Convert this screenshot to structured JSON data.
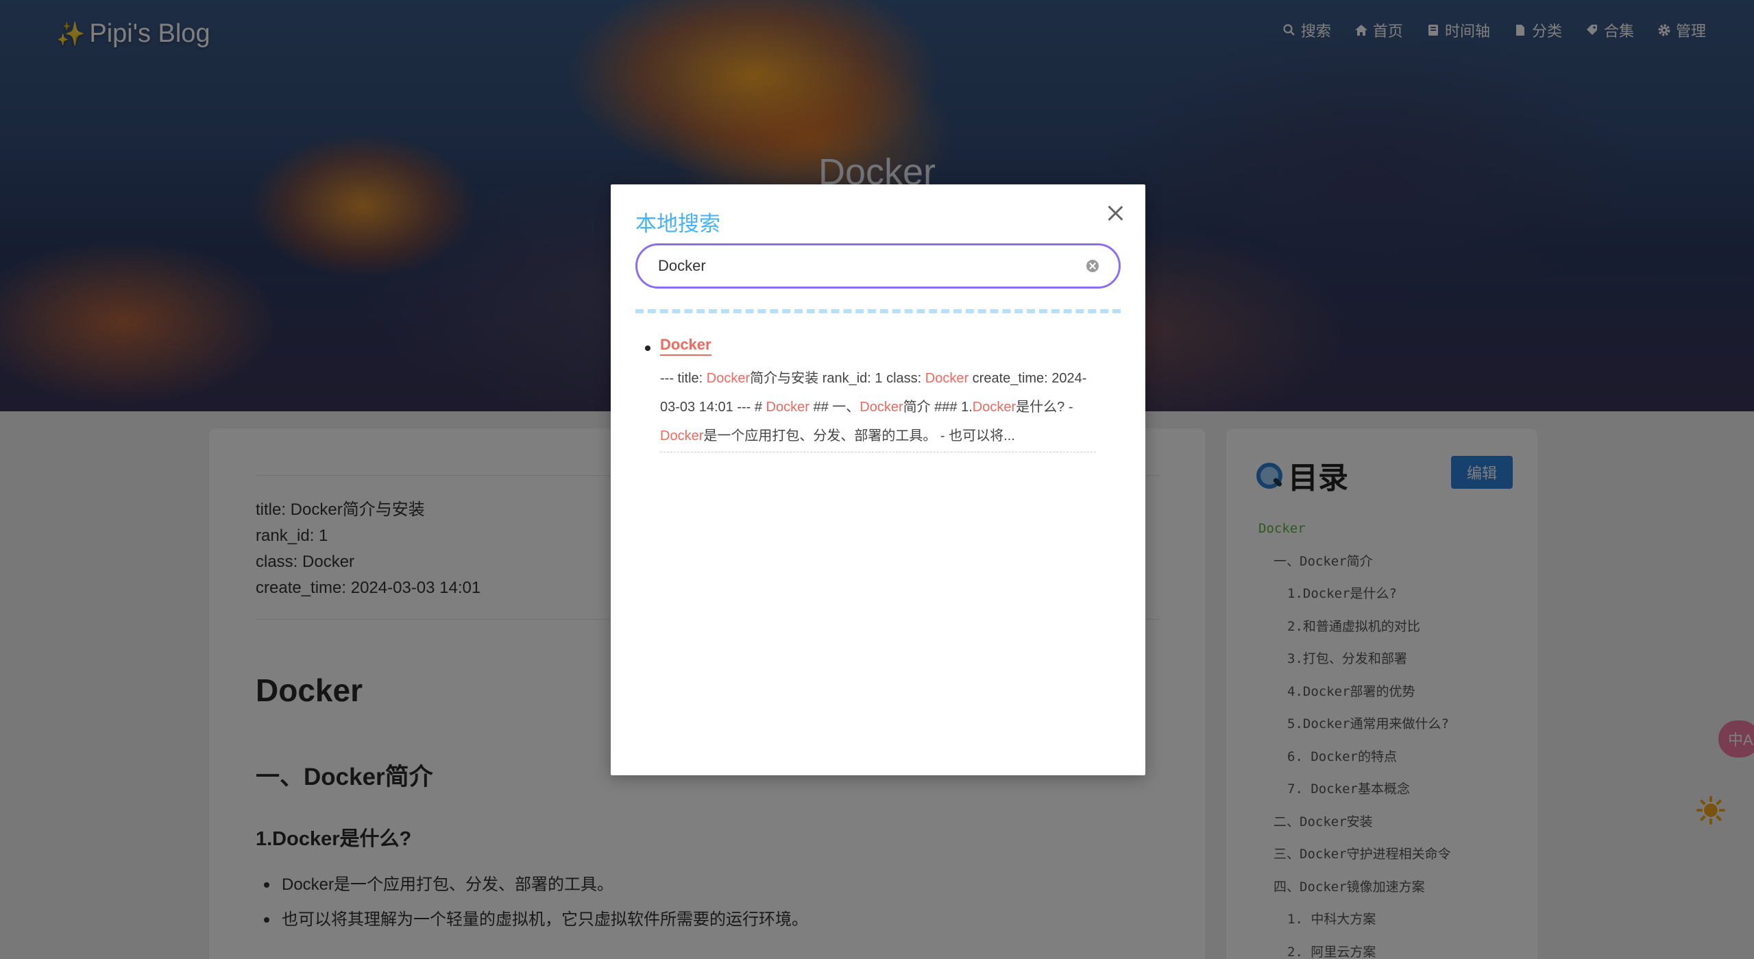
{
  "brand": {
    "icon": "sparkles-icon",
    "name": "Pipi's Blog"
  },
  "nav": [
    {
      "icon": "search-icon",
      "label": "搜索"
    },
    {
      "icon": "home-icon",
      "label": "首页"
    },
    {
      "icon": "archive-icon",
      "label": "时间轴"
    },
    {
      "icon": "folder-icon",
      "label": "分类"
    },
    {
      "icon": "tag-icon",
      "label": "合集"
    },
    {
      "icon": "gear-icon",
      "label": "管理"
    }
  ],
  "hero": {
    "title": "Docker"
  },
  "post": {
    "meta": [
      "title: Docker简介与安装",
      "rank_id: 1",
      "class: Docker",
      "create_time: 2024-03-03 14:01"
    ],
    "h1": "Docker",
    "h2": "一、Docker简介",
    "h3": "1.Docker是什么?",
    "bullets": [
      "Docker是一个应用打包、分发、部署的工具。",
      "也可以将其理解为一个轻量的虚拟机，它只虚拟软件所需要的运行环境。"
    ]
  },
  "toc": {
    "title": "目录",
    "edit_label": "编辑",
    "items": [
      {
        "level": 1,
        "label": "Docker"
      },
      {
        "level": 2,
        "label": "一、Docker简介"
      },
      {
        "level": 3,
        "label": "1.Docker是什么?"
      },
      {
        "level": 3,
        "label": "2.和普通虚拟机的对比"
      },
      {
        "level": 3,
        "label": "3.打包、分发和部署"
      },
      {
        "level": 3,
        "label": "4.Docker部署的优势"
      },
      {
        "level": 3,
        "label": "5.Docker通常用来做什么?"
      },
      {
        "level": 3,
        "label": "6. Docker的特点"
      },
      {
        "level": 3,
        "label": "7. Docker基本概念"
      },
      {
        "level": 2,
        "label": "二、Docker安装"
      },
      {
        "level": 2,
        "label": "三、Docker守护进程相关命令"
      },
      {
        "level": 2,
        "label": "四、Docker镜像加速方案"
      },
      {
        "level": 3,
        "label": "1. 中科大方案"
      },
      {
        "level": 3,
        "label": "2. 阿里云方案"
      }
    ]
  },
  "widgets": {
    "translate_label": "中A",
    "theme_icon": "sun-icon"
  },
  "search_modal": {
    "title": "本地搜索",
    "query": "Docker",
    "results": [
      {
        "title": "Docker",
        "snippet": [
          {
            "t": "--- title: ",
            "hl": false
          },
          {
            "t": "Docker",
            "hl": true
          },
          {
            "t": "简介与安装 rank_id: 1 class: ",
            "hl": false
          },
          {
            "t": "Docker",
            "hl": true
          },
          {
            "t": " create_time: 2024-03-03 14:01 --- # ",
            "hl": false
          },
          {
            "t": "Docker",
            "hl": true
          },
          {
            "t": " ## 一、",
            "hl": false
          },
          {
            "t": "Docker",
            "hl": true
          },
          {
            "t": "简介 ### 1.",
            "hl": false
          },
          {
            "t": "Docker",
            "hl": true
          },
          {
            "t": "是什么? - ",
            "hl": false
          },
          {
            "t": "Docker",
            "hl": true
          },
          {
            "t": "是一个应用打包、分发、部署的工具。 - 也可以将...",
            "hl": false
          }
        ]
      }
    ]
  },
  "colors": {
    "accent": "#49b1f5",
    "highlight": "#ee6a5f",
    "search_border": "#8c6ff0",
    "toc_h1": "#5ab33c"
  }
}
